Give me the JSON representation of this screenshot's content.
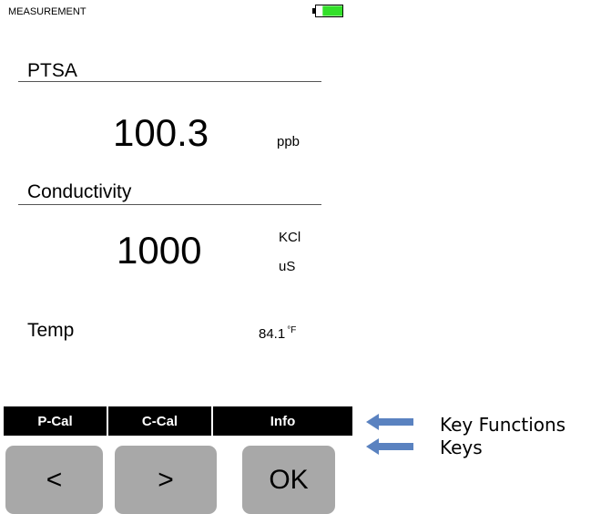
{
  "header": {
    "mode_label": "MEASUREMENT",
    "battery_fill_fraction": 0.75,
    "battery_color": "#33e02a"
  },
  "ptsa": {
    "title": "PTSA",
    "value": "100.3",
    "unit": "ppb"
  },
  "conductivity": {
    "title": "Conductivity",
    "value": "1000",
    "unit_line1": "KCl",
    "unit_line2": "uS"
  },
  "temperature": {
    "label": "Temp",
    "value": "84.1",
    "unit": "°F"
  },
  "softkeys": [
    {
      "label": "P-Cal"
    },
    {
      "label": "C-Cal"
    },
    {
      "label": "Info"
    }
  ],
  "keys": [
    {
      "label": "<"
    },
    {
      "label": ">"
    },
    {
      "label": "OK"
    }
  ],
  "annotations": {
    "key_functions": "Key Functions",
    "keys": "Keys",
    "arrow_color": "#5a82c0"
  }
}
